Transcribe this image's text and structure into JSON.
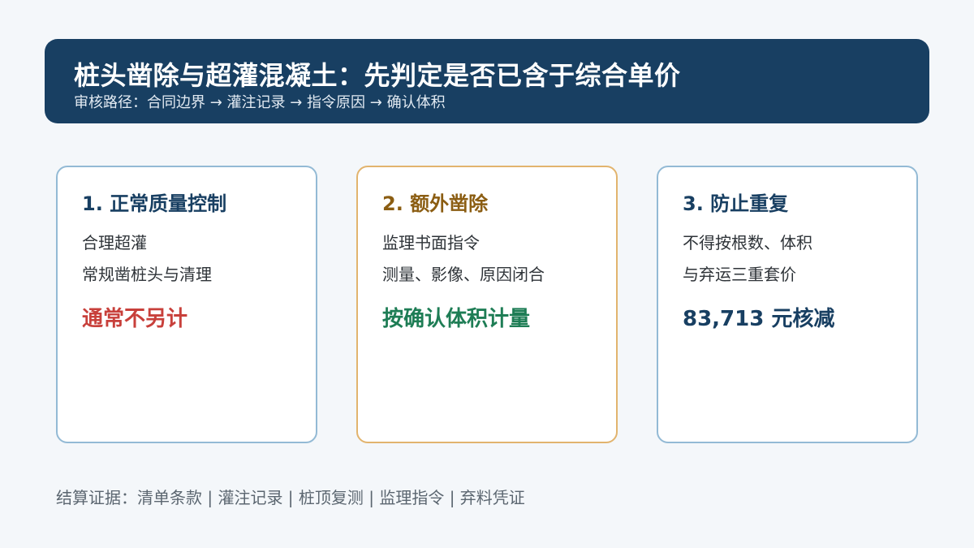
{
  "header": {
    "title": "桩头凿除与超灌混凝土：先判定是否已含于综合单价",
    "subtitle": "审核路径：合同边界 → 灌注记录 → 指令原因 → 确认体积"
  },
  "cards": [
    {
      "title": "1. 正常质量控制",
      "lines": [
        "合理超灌",
        "常规凿桩头与清理"
      ],
      "result": "通常不另计"
    },
    {
      "title": "2. 额外凿除",
      "lines": [
        "监理书面指令",
        "测量、影像、原因闭合"
      ],
      "result": "按确认体积计量"
    },
    {
      "title": "3. 防止重复",
      "lines": [
        "不得按根数、体积",
        "与弃运三重套价"
      ],
      "result": "83,713 元核减"
    }
  ],
  "footer": {
    "text": "结算证据：清单条款 | 灌注记录 | 桩顶复测 | 监理指令 | 弃料凭证"
  },
  "colors": {
    "header_bg": "#183f62",
    "card1_border": "#93bad5",
    "card2_border": "#e2b46e",
    "card3_border": "#93bad5",
    "result_red": "#c8403b",
    "result_green": "#1e7d55",
    "result_navy": "#183f62"
  }
}
